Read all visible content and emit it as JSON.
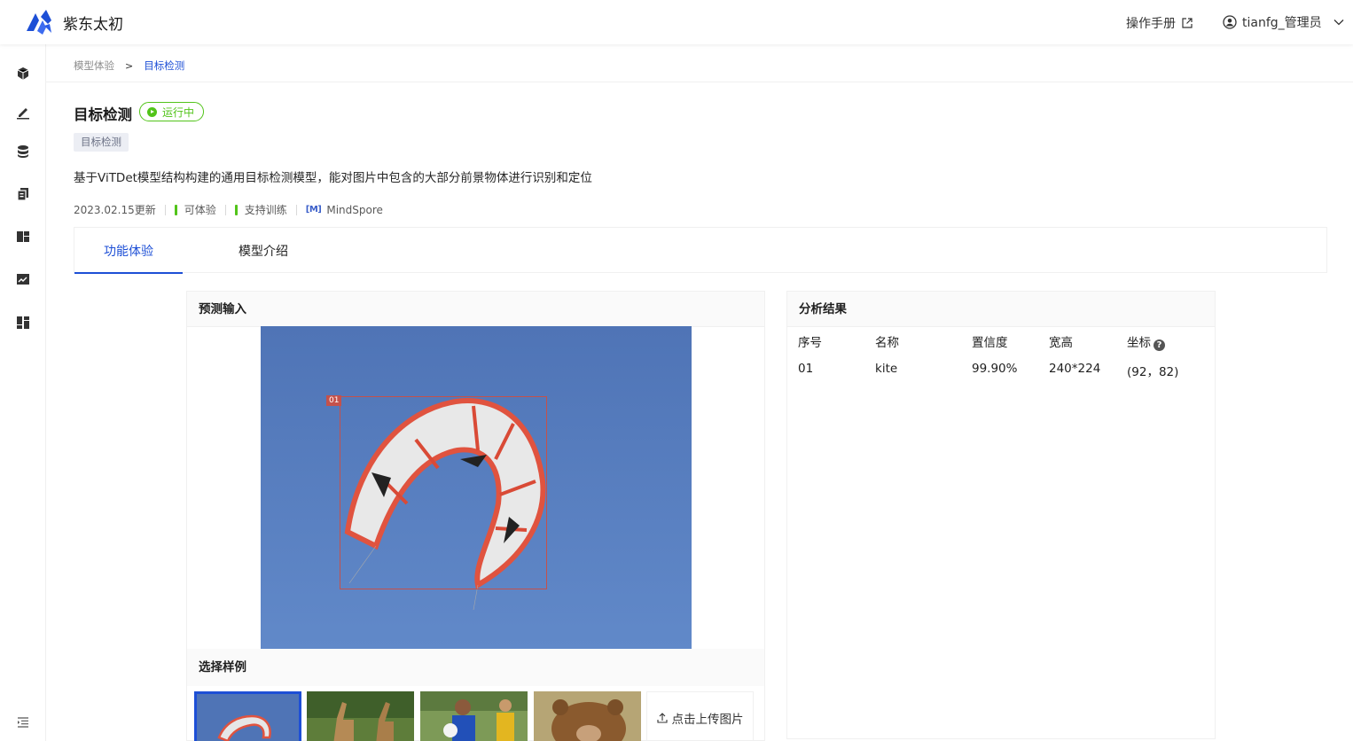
{
  "header": {
    "brand": "紫东太初",
    "manual_label": "操作手册",
    "user_name": "tianfg_管理员"
  },
  "sidebar": {
    "icons": [
      "cube-icon",
      "pen-icon",
      "database-icon",
      "copy-icon",
      "dashboard-icon",
      "chart-icon",
      "layout-icon",
      "menu-indent-icon"
    ]
  },
  "breadcrumb": {
    "parent": "模型体验",
    "separator": ">",
    "current": "目标检测"
  },
  "model": {
    "title": "目标检测",
    "status": "运行中",
    "tag": "目标检测",
    "description": "基于ViTDet模型结构构建的通用目标检测模型，能对图片中包含的大部分前景物体进行识别和定位",
    "updated": "2023.02.15更新",
    "feature_1": "可体验",
    "feature_2": "支持训练",
    "framework_logo": "[M]",
    "framework": "MindSpore"
  },
  "tabs": [
    {
      "label": "功能体验",
      "active": true
    },
    {
      "label": "模型介绍",
      "active": false
    }
  ],
  "input_panel": {
    "title": "预测输入",
    "detection_label": "01",
    "samples_title": "选择样例",
    "samples": [
      "kite",
      "giraffes",
      "soccer",
      "bear"
    ],
    "selected_sample": 0,
    "upload_label": "点击上传图片"
  },
  "result_panel": {
    "title": "分析结果",
    "columns": [
      "序号",
      "名称",
      "置信度",
      "宽高",
      "坐标"
    ],
    "rows": [
      {
        "index": "01",
        "name": "kite",
        "confidence": "99.90%",
        "size": "240*224",
        "coords": "(92，82)"
      }
    ]
  },
  "colors": {
    "primary": "#1d4fd6",
    "success": "#52c41a",
    "bbox": "#c4514b"
  }
}
